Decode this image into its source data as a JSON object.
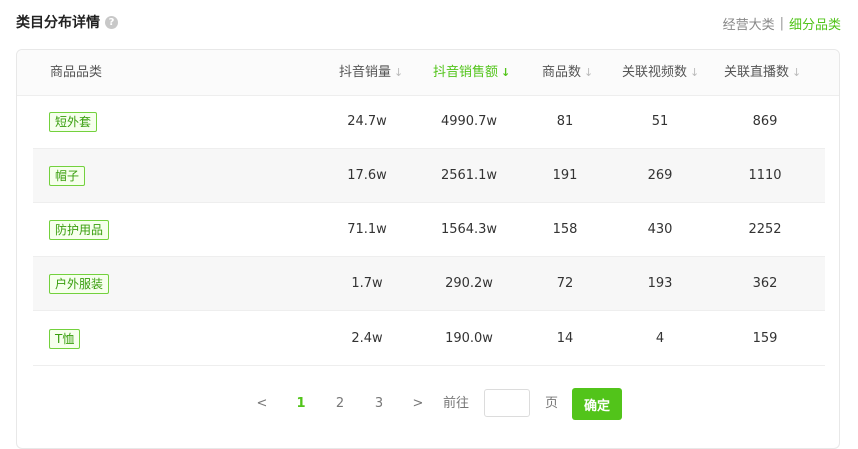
{
  "header": {
    "title": "类目分布详情",
    "help_icon": "question-circle-icon",
    "switch": {
      "option1": "经营大类",
      "separator": "|",
      "option2": "细分品类",
      "active": "细分品类"
    }
  },
  "table": {
    "columns": {
      "category": "商品品类",
      "sales_volume": "抖音销量",
      "sales_amount": "抖音销售额",
      "product_count": "商品数",
      "video_count": "关联视频数",
      "live_count": "关联直播数"
    },
    "sort_icon": "↓",
    "active_sort_column": "抖音销售额",
    "rows": [
      {
        "category": "短外套",
        "sales_volume": "24.7w",
        "sales_amount": "4990.7w",
        "product_count": "81",
        "video_count": "51",
        "live_count": "869"
      },
      {
        "category": "帽子",
        "sales_volume": "17.6w",
        "sales_amount": "2561.1w",
        "product_count": "191",
        "video_count": "269",
        "live_count": "1110"
      },
      {
        "category": "防护用品",
        "sales_volume": "71.1w",
        "sales_amount": "1564.3w",
        "product_count": "158",
        "video_count": "430",
        "live_count": "2252"
      },
      {
        "category": "户外服装",
        "sales_volume": "1.7w",
        "sales_amount": "290.2w",
        "product_count": "72",
        "video_count": "193",
        "live_count": "362"
      },
      {
        "category": "T恤",
        "sales_volume": "2.4w",
        "sales_amount": "190.0w",
        "product_count": "14",
        "video_count": "4",
        "live_count": "159"
      }
    ]
  },
  "pagination": {
    "prev": "<",
    "pages": [
      "1",
      "2",
      "3"
    ],
    "current": "1",
    "next": ">",
    "goto_label": "前往",
    "goto_value": "",
    "page_suffix": "页",
    "confirm": "确定"
  },
  "colors": {
    "accent": "#52c41a",
    "tag_border": "#73d13d",
    "alt_row": "#f7f7f7"
  }
}
